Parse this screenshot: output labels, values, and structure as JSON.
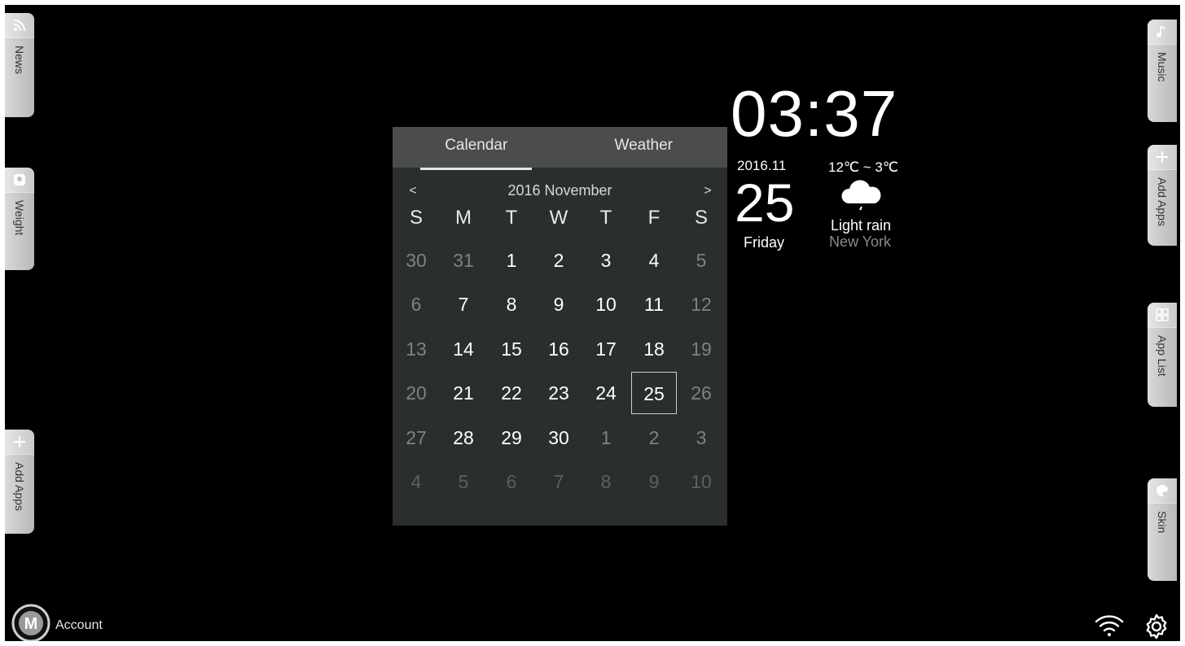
{
  "left_tabs": [
    {
      "label": "News",
      "icon": "rss-icon"
    },
    {
      "label": "Weight",
      "icon": "scale-icon"
    },
    {
      "label": "Add Apps",
      "icon": "plus-icon"
    }
  ],
  "right_tabs": [
    {
      "label": "Music",
      "icon": "music-note-icon"
    },
    {
      "label": "Add Apps",
      "icon": "plus-icon"
    },
    {
      "label": "App List",
      "icon": "grid-icon"
    },
    {
      "label": "Skin",
      "icon": "palette-icon"
    }
  ],
  "calendar": {
    "tabs": [
      "Calendar",
      "Weather"
    ],
    "active_tab": "Calendar",
    "month_title": "2016 November",
    "prev": "<",
    "next": ">",
    "weekdays": [
      "S",
      "M",
      "T",
      "W",
      "T",
      "F",
      "S"
    ],
    "weeks": [
      [
        "30",
        "31",
        "1",
        "2",
        "3",
        "4",
        "5"
      ],
      [
        "6",
        "7",
        "8",
        "9",
        "10",
        "11",
        "12"
      ],
      [
        "13",
        "14",
        "15",
        "16",
        "17",
        "18",
        "19"
      ],
      [
        "20",
        "21",
        "22",
        "23",
        "24",
        "25",
        "26"
      ],
      [
        "27",
        "28",
        "29",
        "30",
        "1",
        "2",
        "3"
      ],
      [
        "4",
        "5",
        "6",
        "7",
        "8",
        "9",
        "10"
      ]
    ],
    "selected_day": "25"
  },
  "clock": {
    "time": "03:37",
    "year_month": "2016.11",
    "day": "25",
    "weekday": "Friday"
  },
  "weather": {
    "temp_range": "12℃ ~ 3℃",
    "condition": "Light rain",
    "city": "New York",
    "icon": "cloud-rain-icon"
  },
  "bottom": {
    "account_label": "Account",
    "logo_letter": "M"
  },
  "colors": {
    "background": "#000000",
    "panel": "#2b2e2f",
    "panel_header": "#4a4c4d",
    "tab": "#c8c8c8"
  }
}
